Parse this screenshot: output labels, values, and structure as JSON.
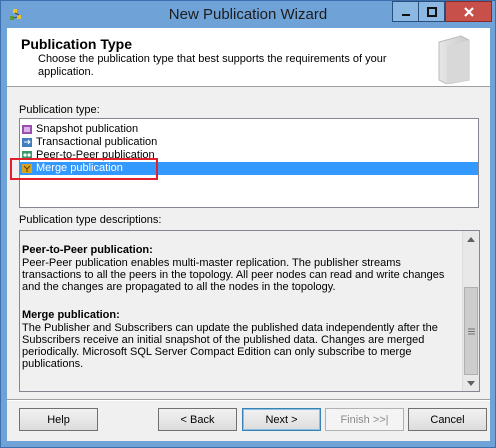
{
  "window": {
    "title": "New Publication Wizard",
    "controls": {
      "minimize": "–",
      "maximize": "□",
      "close": "×"
    }
  },
  "header": {
    "title": "Publication Type",
    "description": "Choose the publication type that best supports the requirements of your application."
  },
  "publication_types": {
    "label": "Publication type:",
    "items": [
      {
        "label": "Snapshot publication",
        "icon": "snapshot-publication-icon"
      },
      {
        "label": "Transactional publication",
        "icon": "transactional-publication-icon"
      },
      {
        "label": "Peer-to-Peer publication",
        "icon": "peer-to-peer-publication-icon"
      },
      {
        "label": "Merge publication",
        "icon": "merge-publication-icon",
        "selected": true
      }
    ]
  },
  "descriptions": {
    "label": "Publication type descriptions:",
    "sections": [
      {
        "title": "Peer-to-Peer publication:",
        "body": "Peer-Peer publication enables multi-master replication. The publisher streams transactions to all the peers in the topology. All peer nodes can read and write changes and the changes are propagated to all the nodes in the topology."
      },
      {
        "title": "Merge publication:",
        "body": "The Publisher and Subscribers can update the published data independently after the Subscribers receive an initial snapshot of the published data. Changes are merged periodically. Microsoft SQL Server Compact Edition can only subscribe to merge publications."
      }
    ]
  },
  "buttons": {
    "help": "Help",
    "back": "< Back",
    "next": "Next >",
    "finish": "Finish >>|",
    "cancel": "Cancel"
  },
  "colors": {
    "selection": "#3399ff",
    "highlight_box": "#e0202a",
    "titlebar": "#6fa3d8",
    "close_button": "#c7504b"
  }
}
